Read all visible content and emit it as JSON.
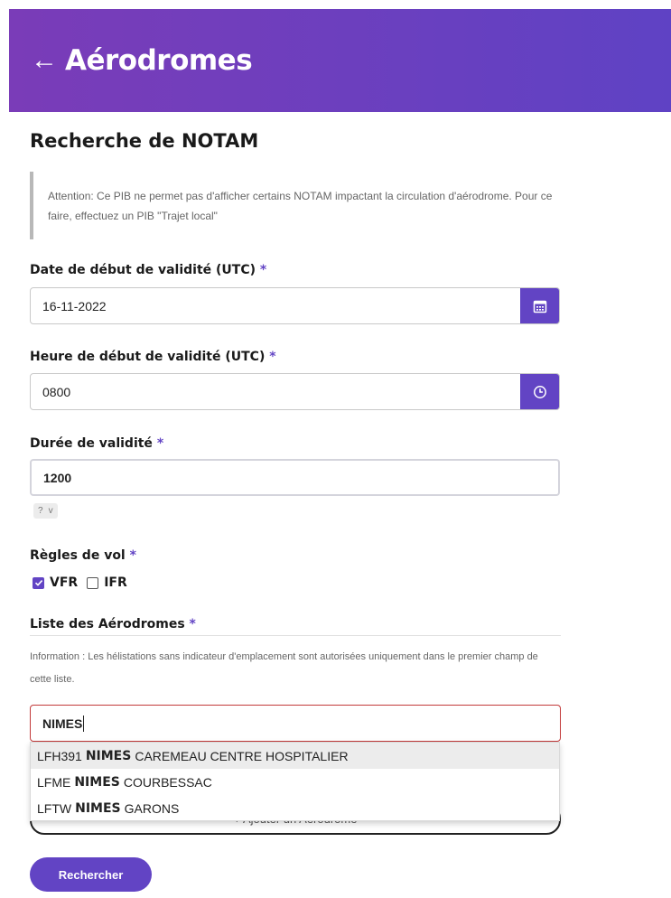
{
  "header": {
    "title": "Aérodromes"
  },
  "page": {
    "title": "Recherche de NOTAM"
  },
  "notice": {
    "text": "Attention: Ce PIB ne permet pas d'afficher certains NOTAM impactant la circulation d'aérodrome. Pour ce faire, effectuez un PIB \"Trajet local\""
  },
  "start_date": {
    "label": "Date de début de validité (UTC)",
    "required": "*",
    "value": "16-11-2022",
    "icon": "calendar-icon"
  },
  "start_time": {
    "label": "Heure de début de validité (UTC)",
    "required": "*",
    "value": "0800",
    "icon": "clock-icon"
  },
  "duration": {
    "label": "Durée de validité",
    "required": "*",
    "value": "1200",
    "badge_q": "?",
    "badge_v": "v"
  },
  "flight_rules": {
    "label": "Règles de vol",
    "required": "*",
    "options": [
      {
        "label": "VFR",
        "checked": true
      },
      {
        "label": "IFR",
        "checked": false
      }
    ]
  },
  "aerodromes": {
    "label": "Liste des Aérodromes",
    "required": "*",
    "info": "Information : Les hélistations sans indicateur d'emplacement sont autorisées uniquement dans le premier champ de cette liste.",
    "search_value": "NIMES",
    "add_label": "+ Ajouter un Aérodrome",
    "suggestions": [
      {
        "code": "LFH391",
        "match": "NIMES",
        "rest": "CAREMEAU CENTRE HOSPITALIER"
      },
      {
        "code": "LFME",
        "match": "NIMES",
        "rest": "COURBESSAC"
      },
      {
        "code": "LFTW",
        "match": "NIMES",
        "rest": "GARONS"
      }
    ]
  },
  "search_button": {
    "label": "Rechercher"
  },
  "colors": {
    "accent": "#6244c4",
    "header_start": "#7a3cb8",
    "error_border": "#c23a3a"
  }
}
